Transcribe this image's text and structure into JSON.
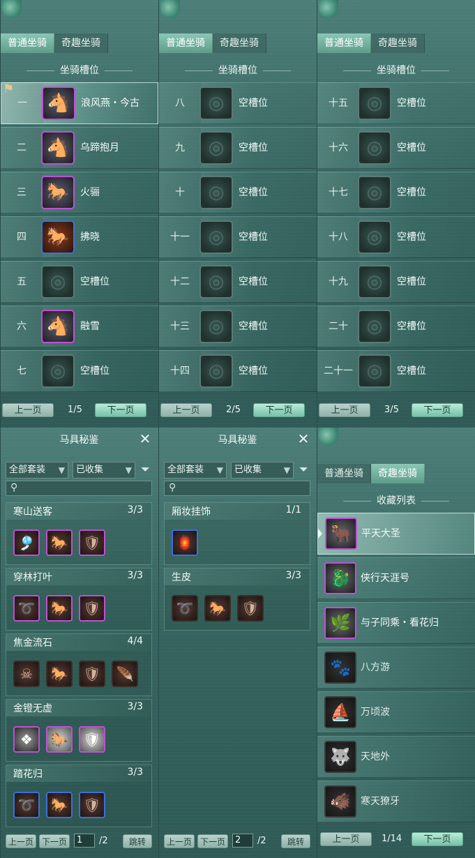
{
  "mount_tabs": {
    "normal": "普通坐骑",
    "fun": "奇趣坐骑"
  },
  "slot_title": "坐骑槽位",
  "panels": [
    {
      "slots": [
        {
          "num": "一",
          "name": "浪风燕・今古",
          "icon": "white-horse-icon",
          "frame": "purple",
          "selected": true
        },
        {
          "num": "二",
          "name": "乌蹄抱月",
          "icon": "grey-horse-icon",
          "frame": "purple"
        },
        {
          "num": "三",
          "name": "火骊",
          "icon": "dark-horse-icon",
          "frame": "purple"
        },
        {
          "num": "四",
          "name": "拂晓",
          "icon": "chestnut-horse-icon",
          "frame": "blue"
        },
        {
          "num": "五",
          "name": "空槽位",
          "icon": "empty-slot-icon",
          "frame": "empty"
        },
        {
          "num": "六",
          "name": "融雪",
          "icon": "snow-horse-icon",
          "frame": "purple"
        },
        {
          "num": "七",
          "name": "空槽位",
          "icon": "empty-slot-icon",
          "frame": "empty"
        }
      ],
      "page": "1/5"
    },
    {
      "slots": [
        {
          "num": "八",
          "name": "空槽位"
        },
        {
          "num": "九",
          "name": "空槽位"
        },
        {
          "num": "十",
          "name": "空槽位"
        },
        {
          "num": "十一",
          "name": "空槽位"
        },
        {
          "num": "十二",
          "name": "空槽位"
        },
        {
          "num": "十三",
          "name": "空槽位"
        },
        {
          "num": "十四",
          "name": "空槽位"
        }
      ],
      "page": "2/5"
    },
    {
      "slots": [
        {
          "num": "十五",
          "name": "空槽位"
        },
        {
          "num": "十六",
          "name": "空槽位"
        },
        {
          "num": "十七",
          "name": "空槽位"
        },
        {
          "num": "十八",
          "name": "空槽位"
        },
        {
          "num": "十九",
          "name": "空槽位"
        },
        {
          "num": "二十",
          "name": "空槽位"
        },
        {
          "num": "二十一",
          "name": "空槽位"
        }
      ],
      "page": "3/5"
    }
  ],
  "pager": {
    "prev": "上一页",
    "next": "下一页",
    "jump": "跳转"
  },
  "gear": {
    "title": "马具秘鉴",
    "filter_set": "全部套装",
    "filter_status": "已收集",
    "left": {
      "sets": [
        {
          "name": "寒山送客",
          "count": "3/3",
          "icons": [
            "p",
            "p",
            "p"
          ]
        },
        {
          "name": "穿林打叶",
          "count": "3/3",
          "icons": [
            "p",
            "p",
            "p"
          ]
        },
        {
          "name": "焦金流石",
          "count": "4/4",
          "icons": [
            "d",
            "d",
            "d",
            "d"
          ]
        },
        {
          "name": "金镫无虚",
          "count": "3/3",
          "icons": [
            "p",
            "p",
            "p"
          ]
        },
        {
          "name": "踏花归",
          "count": "3/3",
          "icons": [
            "b",
            "b",
            "b"
          ]
        }
      ],
      "page_input": "1",
      "page_total": "/2"
    },
    "right": {
      "sets": [
        {
          "name": "厢妆挂饰",
          "count": "1/1",
          "icons": [
            "b"
          ]
        },
        {
          "name": "生皮",
          "count": "3/3",
          "icons": [
            "d",
            "d",
            "d"
          ]
        }
      ],
      "page_input": "2",
      "page_total": "/2"
    }
  },
  "collection": {
    "title": "收藏列表",
    "items": [
      {
        "name": "平天大圣",
        "frame": "p",
        "icon": "ox-mount-icon",
        "selected": true
      },
      {
        "name": "侠行天涯号",
        "frame": "p",
        "icon": "dragon-boat-icon"
      },
      {
        "name": "与子同乘・看花归",
        "frame": "p",
        "icon": "horse-carriage-icon"
      },
      {
        "name": "八方游",
        "frame": "g",
        "icon": "locked-mount-icon"
      },
      {
        "name": "万顷波",
        "frame": "g",
        "icon": "locked-mount-icon"
      },
      {
        "name": "天地外",
        "frame": "g",
        "icon": "locked-mount-icon"
      },
      {
        "name": "寒天獠牙",
        "frame": "g",
        "icon": "locked-mount-icon"
      }
    ],
    "page": "1/14"
  }
}
